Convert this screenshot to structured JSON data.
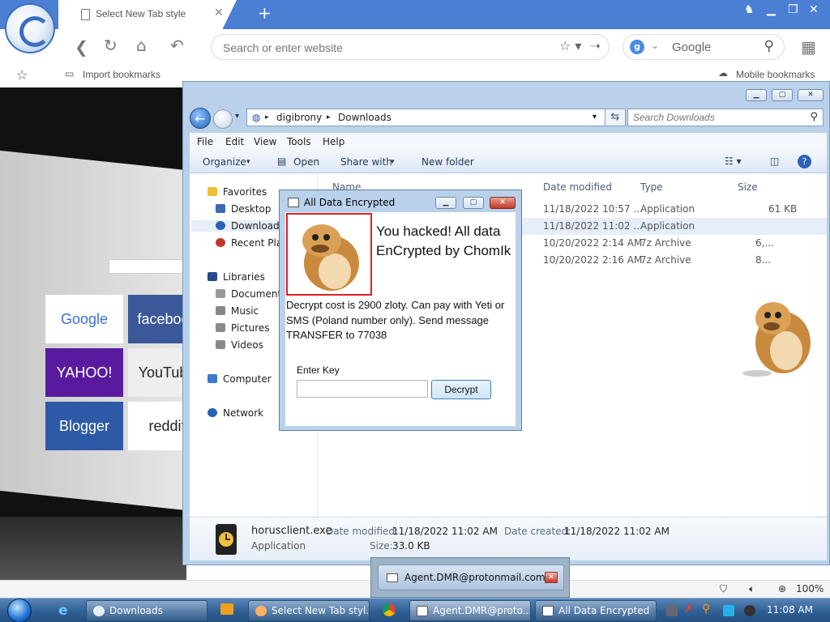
{
  "browser": {
    "tab_title": "Select New Tab style",
    "address_placeholder": "Search or enter website",
    "search_engine_name": "Google",
    "search_engine_letter": "g",
    "bookmarks": {
      "import_label": "Import bookmarks",
      "mobile_label": "Mobile bookmarks"
    },
    "zoom_level": "100%"
  },
  "newtab_tiles": [
    "Google",
    "facebook",
    "YAHOO!",
    "YouTube",
    "Blogger",
    "reddit"
  ],
  "explorer": {
    "breadcrumb": [
      "digibrony",
      "Downloads"
    ],
    "search_placeholder": "Search Downloads",
    "menu": [
      "File",
      "Edit",
      "View",
      "Tools",
      "Help"
    ],
    "commands": [
      "Organize",
      "Open",
      "Share with",
      "New folder"
    ],
    "nav": {
      "favorites": "Favorites",
      "favorites_items": [
        "Desktop",
        "Downloads",
        "Recent Places"
      ],
      "libraries": "Libraries",
      "libraries_items": [
        "Documents",
        "Music",
        "Pictures",
        "Videos"
      ],
      "computer": "Computer",
      "network": "Network"
    },
    "columns": {
      "name": "Name",
      "date_modified": "Date modified",
      "type": "Type",
      "size": "Size"
    },
    "rows": [
      {
        "date": "11/18/2022 10:57 ...",
        "type": "Application",
        "size": "61 KB"
      },
      {
        "date": "11/18/2022 11:02 ...",
        "type": "Application",
        "size": ""
      },
      {
        "date": "10/20/2022 2:14 AM",
        "type": "7z Archive",
        "size": "6,..."
      },
      {
        "date": "10/20/2022 2:16 AM",
        "type": "7z Archive",
        "size": "8..."
      }
    ],
    "details": {
      "file_name": "horusclient.exe",
      "file_type": "Application",
      "modified_label": "Date modified:",
      "modified_value": "11/18/2022 11:02 AM",
      "created_label": "Date created:",
      "created_value": "11/18/2022 11:02 AM",
      "size_label": "Size:",
      "size_value": "33.0 KB"
    }
  },
  "ransom": {
    "title": "All Data Encrypted",
    "headline": "You hacked! All data EnCrypted by ChomIk",
    "message": "Decrypt cost is 2900 zloty. Can pay with Yeti or SMS (Poland number only). Send message TRANSFER to 77038",
    "key_label": "Enter Key",
    "key_value": "",
    "decrypt_label": "Decrypt"
  },
  "popup": {
    "label": "Agent.DMR@protonmail.com"
  },
  "taskbar": {
    "buttons": [
      "Downloads",
      "Select New Tab styl...",
      "Agent.DMR@proto...",
      "All Data Encrypted"
    ],
    "clock": "11:08 AM"
  },
  "colors": {
    "accent": "#4a7fd4",
    "alert_border": "#e02020"
  }
}
